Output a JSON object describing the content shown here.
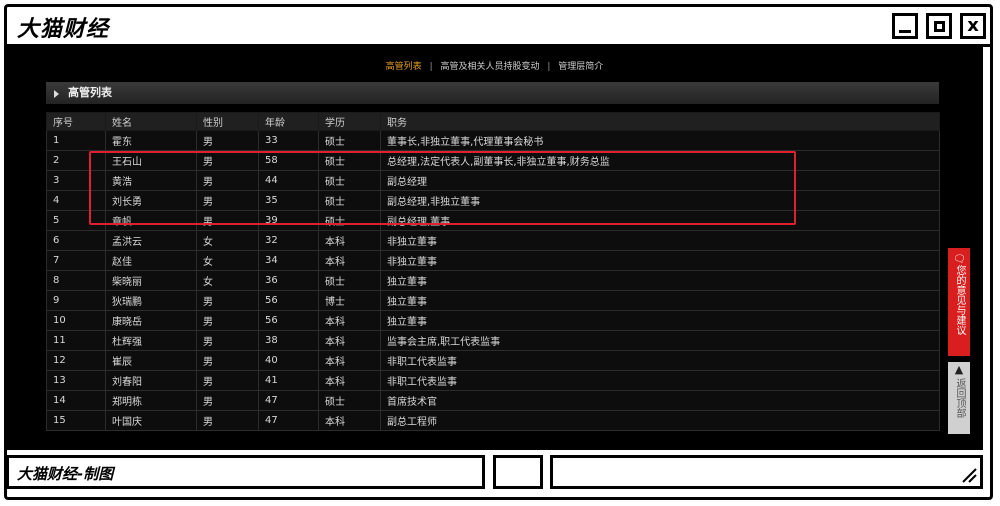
{
  "window": {
    "title": "大猫财经",
    "footer_text": "大猫财经-制图"
  },
  "nav": {
    "items": [
      "高管列表",
      "高管及相关人员持股变动",
      "管理层简介"
    ],
    "active_index": 0
  },
  "section": {
    "title": "高管列表"
  },
  "table": {
    "headers": [
      "序号",
      "姓名",
      "性别",
      "年龄",
      "学历",
      "职务"
    ],
    "rows": [
      [
        "1",
        "霍东",
        "男",
        "33",
        "硕士",
        "董事长,非独立董事,代理董事会秘书"
      ],
      [
        "2",
        "王石山",
        "男",
        "58",
        "硕士",
        "总经理,法定代表人,副董事长,非独立董事,财务总监"
      ],
      [
        "3",
        "黄浩",
        "男",
        "44",
        "硕士",
        "副总经理"
      ],
      [
        "4",
        "刘长勇",
        "男",
        "35",
        "硕士",
        "副总经理,非独立董事"
      ],
      [
        "5",
        "章帆",
        "男",
        "39",
        "硕士",
        "副总经理,董事"
      ],
      [
        "6",
        "孟洪云",
        "女",
        "32",
        "本科",
        "非独立董事"
      ],
      [
        "7",
        "赵佳",
        "女",
        "34",
        "本科",
        "非独立董事"
      ],
      [
        "8",
        "柴晓丽",
        "女",
        "36",
        "硕士",
        "独立董事"
      ],
      [
        "9",
        "狄瑞鹏",
        "男",
        "56",
        "博士",
        "独立董事"
      ],
      [
        "10",
        "康晓岳",
        "男",
        "56",
        "本科",
        "独立董事"
      ],
      [
        "11",
        "杜辉强",
        "男",
        "38",
        "本科",
        "监事会主席,职工代表监事"
      ],
      [
        "12",
        "崔辰",
        "男",
        "40",
        "本科",
        "非职工代表监事"
      ],
      [
        "13",
        "刘春阳",
        "男",
        "41",
        "本科",
        "非职工代表监事"
      ],
      [
        "14",
        "郑明栋",
        "男",
        "47",
        "硕士",
        "首席技术官"
      ],
      [
        "15",
        "叶国庆",
        "男",
        "47",
        "本科",
        "副总工程师"
      ]
    ]
  },
  "sidebar_buttons": {
    "feedback": "您的意见与建议",
    "back_top": "返回顶部"
  },
  "colors": {
    "highlight_border": "#e02030",
    "active_nav": "#e8a020",
    "feedback_bg": "#d81e1e"
  },
  "icons": {
    "feedback": "chat-icon",
    "back_top": "up-arrow-icon"
  }
}
